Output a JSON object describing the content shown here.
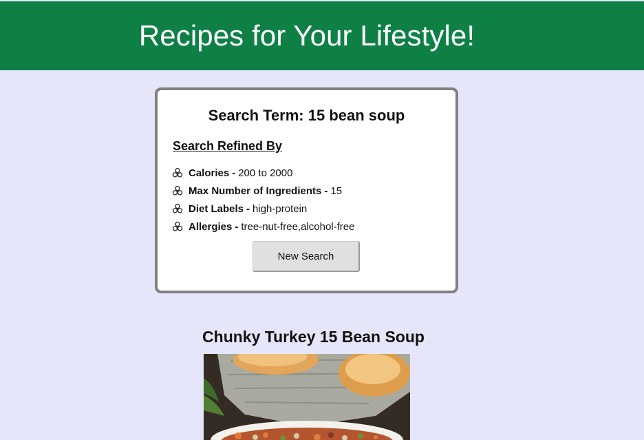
{
  "header": {
    "title": "Recipes for Your Lifestyle!",
    "background_color": "#0e8046"
  },
  "search": {
    "title": "Search Term: 15 bean soup",
    "refined_heading": "Search Refined By",
    "filters": [
      {
        "label": "Calories",
        "value": "200 to 2000",
        "icon": "biohazard-icon"
      },
      {
        "label": "Max Number of Ingredients",
        "value": "15",
        "icon": "biohazard-icon"
      },
      {
        "label": "Diet Labels",
        "value": "high-protein",
        "icon": "biohazard-icon"
      },
      {
        "label": "Allergies",
        "value": "tree-nut-free,alcohol-free",
        "icon": "biohazard-icon"
      }
    ],
    "separator": "-",
    "new_search_label": "New Search"
  },
  "recipe": {
    "title": "Chunky Turkey 15 Bean Soup",
    "image_alt": "bowl of turkey bean soup with biscuits"
  },
  "colors": {
    "page_background": "#e6e6fa",
    "card_border": "#808080"
  }
}
